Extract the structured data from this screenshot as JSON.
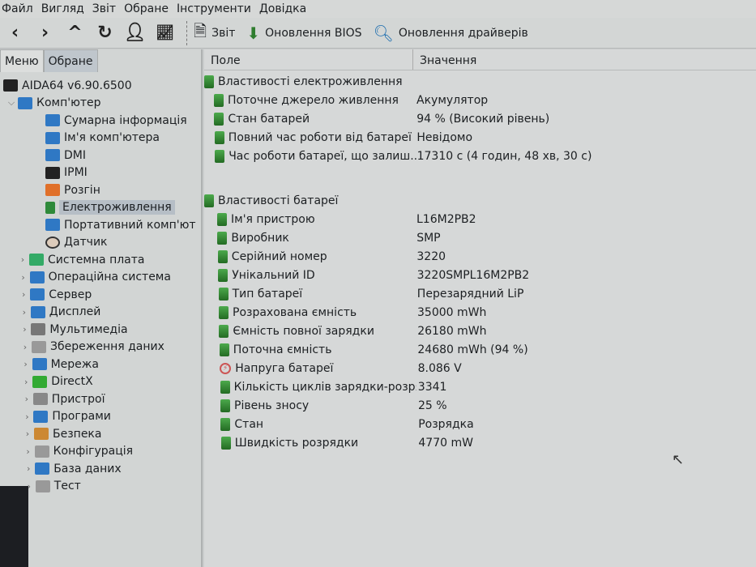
{
  "menu": [
    "Файл",
    "Вигляд",
    "Звіт",
    "Обране",
    "Інструменти",
    "Довідка"
  ],
  "toolbar": {
    "report": "Звіт",
    "bios": "Оновлення BIOS",
    "drivers": "Оновлення драйверів"
  },
  "tabs": [
    "Меню",
    "Обране"
  ],
  "tree": {
    "root": "AIDA64 v6.90.6500",
    "computer": "Комп'ютер",
    "children": [
      "Сумарна інформація",
      "Ім'я комп'ютера",
      "DMI",
      "IPMI",
      "Розгін",
      "Електроживлення",
      "Портативний комп'ют",
      "Датчик"
    ],
    "top": [
      "Системна плата",
      "Операційна система",
      "Сервер",
      "Дисплей",
      "Мультимедіа",
      "Збереження даних",
      "Мережа",
      "DirectX",
      "Пристрої",
      "Програми",
      "Безпека",
      "Конфігурація",
      "База даних",
      "Тест"
    ]
  },
  "columns": {
    "field": "Поле",
    "value": "Значення"
  },
  "power": {
    "title": "Властивості електроживлення",
    "rows": [
      {
        "f": "Поточне джерело живлення",
        "v": "Акумулятор"
      },
      {
        "f": "Стан батарей",
        "v": "94 % (Високий рівень)"
      },
      {
        "f": "Повний час роботи від батареї",
        "v": "Невідомо"
      },
      {
        "f": "Час роботи батареї, що залиш...",
        "v": "17310 с (4 годин, 48 хв, 30 с)"
      }
    ]
  },
  "battery": {
    "title": "Властивості батареї",
    "rows": [
      {
        "f": "Ім'я пристрою",
        "v": "L16M2PB2"
      },
      {
        "f": "Виробник",
        "v": "SMP"
      },
      {
        "f": "Серійний номер",
        "v": "3220"
      },
      {
        "f": "Унікальний ID",
        "v": "3220SMPL16M2PB2"
      },
      {
        "f": "Тип батареї",
        "v": "Перезарядний LiP"
      },
      {
        "f": "Розрахована ємність",
        "v": "35000 mWh"
      },
      {
        "f": "Ємність повної зарядки",
        "v": "26180 mWh"
      },
      {
        "f": "Поточна ємність",
        "v": "24680 mWh  (94 %)"
      },
      {
        "f": "Напруга батареї",
        "v": "8.086 V"
      },
      {
        "f": "Кількість циклів зарядки-розря...",
        "v": "3341"
      },
      {
        "f": "Рівень зносу",
        "v": "25 %"
      },
      {
        "f": "Стан",
        "v": "Розрядка"
      },
      {
        "f": "Швидкість розрядки",
        "v": "4770 mW"
      }
    ]
  }
}
